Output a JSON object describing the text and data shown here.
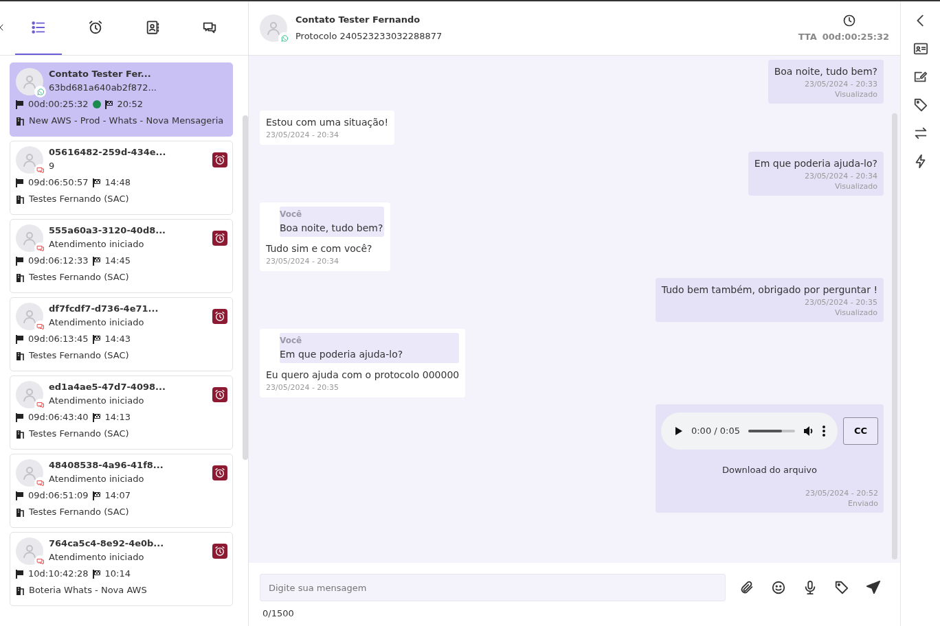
{
  "sidebar": {
    "tabs": [
      {
        "selected": true
      },
      {
        "selected": false
      },
      {
        "selected": false
      },
      {
        "selected": false
      }
    ],
    "conversations": [
      {
        "name": "Contato Tester Fer...",
        "subtitle": "63bd681a640ab2f872...",
        "duration": "00d:00:25:32",
        "time": "20:52",
        "queue": "New AWS - Prod - Whats - Nova Mensageria",
        "kind": "whatsapp",
        "online": true,
        "alarm": false,
        "selected": true
      },
      {
        "name": "05616482-259d-434e...",
        "subtitle": "9",
        "duration": "09d:06:50:57",
        "time": "14:48",
        "queue": "Testes Fernando (SAC)",
        "kind": "chat",
        "online": false,
        "alarm": true,
        "selected": false
      },
      {
        "name": "555a60a3-3120-40d8...",
        "subtitle": "Atendimento iniciado",
        "duration": "09d:06:12:33",
        "time": "14:45",
        "queue": "Testes Fernando (SAC)",
        "kind": "chat",
        "online": false,
        "alarm": true,
        "selected": false
      },
      {
        "name": "df7fcdf7-d736-4e71...",
        "subtitle": "Atendimento iniciado",
        "duration": "09d:06:13:45",
        "time": "14:43",
        "queue": "Testes Fernando (SAC)",
        "kind": "chat",
        "online": false,
        "alarm": true,
        "selected": false
      },
      {
        "name": "ed1a4ae5-47d7-4098...",
        "subtitle": "Atendimento iniciado",
        "duration": "09d:06:43:40",
        "time": "14:13",
        "queue": "Testes Fernando (SAC)",
        "kind": "chat",
        "online": false,
        "alarm": true,
        "selected": false
      },
      {
        "name": "48408538-4a96-41f8...",
        "subtitle": "Atendimento iniciado",
        "duration": "09d:06:51:09",
        "time": "14:07",
        "queue": "Testes Fernando (SAC)",
        "kind": "chat",
        "online": false,
        "alarm": true,
        "selected": false
      },
      {
        "name": "764ca5c4-8e92-4e0b...",
        "subtitle": "Atendimento iniciado",
        "duration": "10d:10:42:28",
        "time": "10:14",
        "queue": "Boteria Whats - Nova AWS",
        "kind": "chat",
        "online": false,
        "alarm": true,
        "selected": false
      }
    ]
  },
  "header": {
    "contact": "Contato Tester Fernando",
    "protocol": "Protocolo 240523233032288877",
    "kind": "whatsapp",
    "tta_label": "TTA",
    "tta_value": "00d:00:25:32"
  },
  "messages": [
    {
      "kind": "out",
      "text": "Boa noite, tudo bem?",
      "date": "23/05/2024 - 20:33",
      "status": "Visualizado"
    },
    {
      "kind": "in",
      "text": "Estou com uma situação!",
      "date": "23/05/2024 - 20:34"
    },
    {
      "kind": "out",
      "text": "Em que poderia ajuda-lo?",
      "date": "23/05/2024 - 20:34",
      "status": "Visualizado"
    },
    {
      "kind": "in",
      "quote": {
        "author": "Você",
        "text": "Boa noite, tudo bem?"
      },
      "text": "Tudo sim e com você?",
      "date": "23/05/2024 - 20:34"
    },
    {
      "kind": "out",
      "text": "Tudo bem também, obrigado por perguntar !",
      "date": "23/05/2024 - 20:35",
      "status": "Visualizado"
    },
    {
      "kind": "in",
      "quote": {
        "author": "Você",
        "text": "Em que poderia ajuda-lo?"
      },
      "text": "Eu quero ajuda com o protocolo 000000",
      "date": "23/05/2024 - 20:35"
    },
    {
      "kind": "audio",
      "time": "0:00 / 0:05",
      "level": 0.72,
      "cc": "CC",
      "download": "Download do arquivo",
      "date": "23/05/2024 - 20:52",
      "status": "Enviado"
    }
  ],
  "composer": {
    "placeholder": "Digite sua mensagem",
    "counter": "0/1500"
  }
}
